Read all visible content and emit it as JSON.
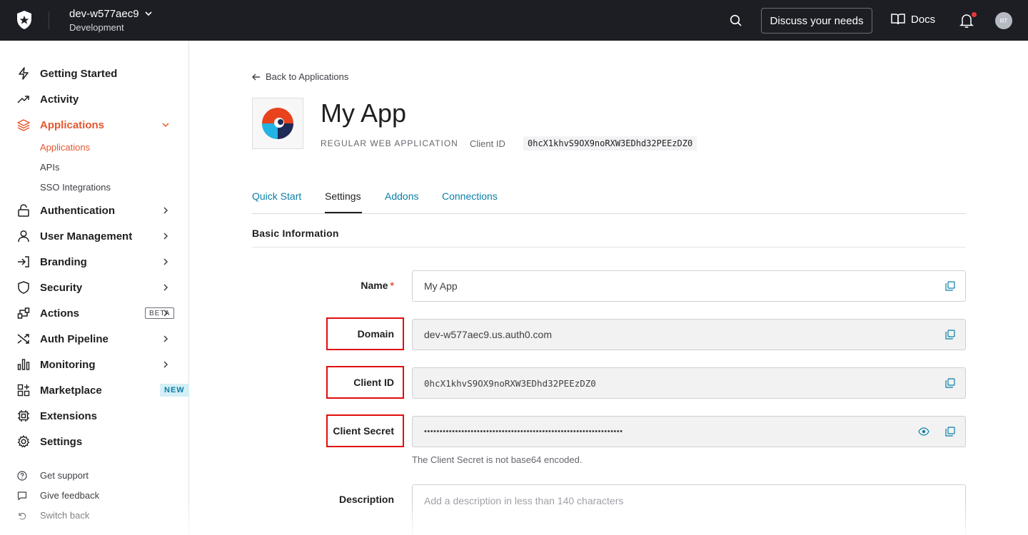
{
  "topbar": {
    "tenant_name": "dev-w577aec9",
    "tenant_env": "Development",
    "discuss_label": "Discuss your needs",
    "docs_label": "Docs",
    "avatar_initials": "RT",
    "icons": [
      "auth0-logo-icon",
      "chevron-down-icon",
      "search-icon",
      "book-icon",
      "bell-icon"
    ]
  },
  "sidebar": {
    "items": [
      {
        "label": "Getting Started",
        "icon": "bolt-icon"
      },
      {
        "label": "Activity",
        "icon": "trend-icon"
      },
      {
        "label": "Applications",
        "icon": "layers-icon",
        "active": true
      },
      {
        "label": "Authentication",
        "icon": "lock-icon"
      },
      {
        "label": "User Management",
        "icon": "user-icon"
      },
      {
        "label": "Branding",
        "icon": "login-icon"
      },
      {
        "label": "Security",
        "icon": "shield-icon"
      },
      {
        "label": "Actions",
        "icon": "actions-icon",
        "badge": "BETA"
      },
      {
        "label": "Auth Pipeline",
        "icon": "shuffle-icon"
      },
      {
        "label": "Monitoring",
        "icon": "bar-chart-icon"
      },
      {
        "label": "Marketplace",
        "icon": "grid-plus-icon",
        "badge": "NEW"
      },
      {
        "label": "Extensions",
        "icon": "chip-icon"
      },
      {
        "label": "Settings",
        "icon": "gear-icon"
      }
    ],
    "sub_items": [
      "Applications",
      "APIs",
      "SSO Integrations"
    ],
    "footer": [
      "Get support",
      "Give feedback",
      "Switch back"
    ]
  },
  "main": {
    "back_label": "Back to Applications",
    "app_name": "My App",
    "app_type": "REGULAR WEB APPLICATION",
    "client_id_label": "Client ID",
    "client_id": "0hcX1khvS9OX9noRXW3EDhd32PEEzDZ0",
    "tabs": [
      "Quick Start",
      "Settings",
      "Addons",
      "Connections"
    ],
    "active_tab": "Settings",
    "section_title": "Basic Information",
    "fields": {
      "name_label": "Name",
      "name_required": "*",
      "name_value": "My App",
      "domain_label": "Domain",
      "domain_value": "dev-w577aec9.us.auth0.com",
      "client_id_label": "Client ID",
      "client_id_value": "0hcX1khvS9OX9noRXW3EDhd32PEEzDZ0",
      "client_secret_label": "Client Secret",
      "client_secret_value": "••••••••••••••••••••••••••••••••••••••••••••••••••••••••••••••••",
      "client_secret_helper": "The Client Secret is not base64 encoded.",
      "description_label": "Description",
      "description_placeholder": "Add a description in less than 140 characters"
    },
    "highlight_color": "#e30d0d",
    "accent_color": "#e4572e",
    "link_color": "#0a7ea6"
  }
}
